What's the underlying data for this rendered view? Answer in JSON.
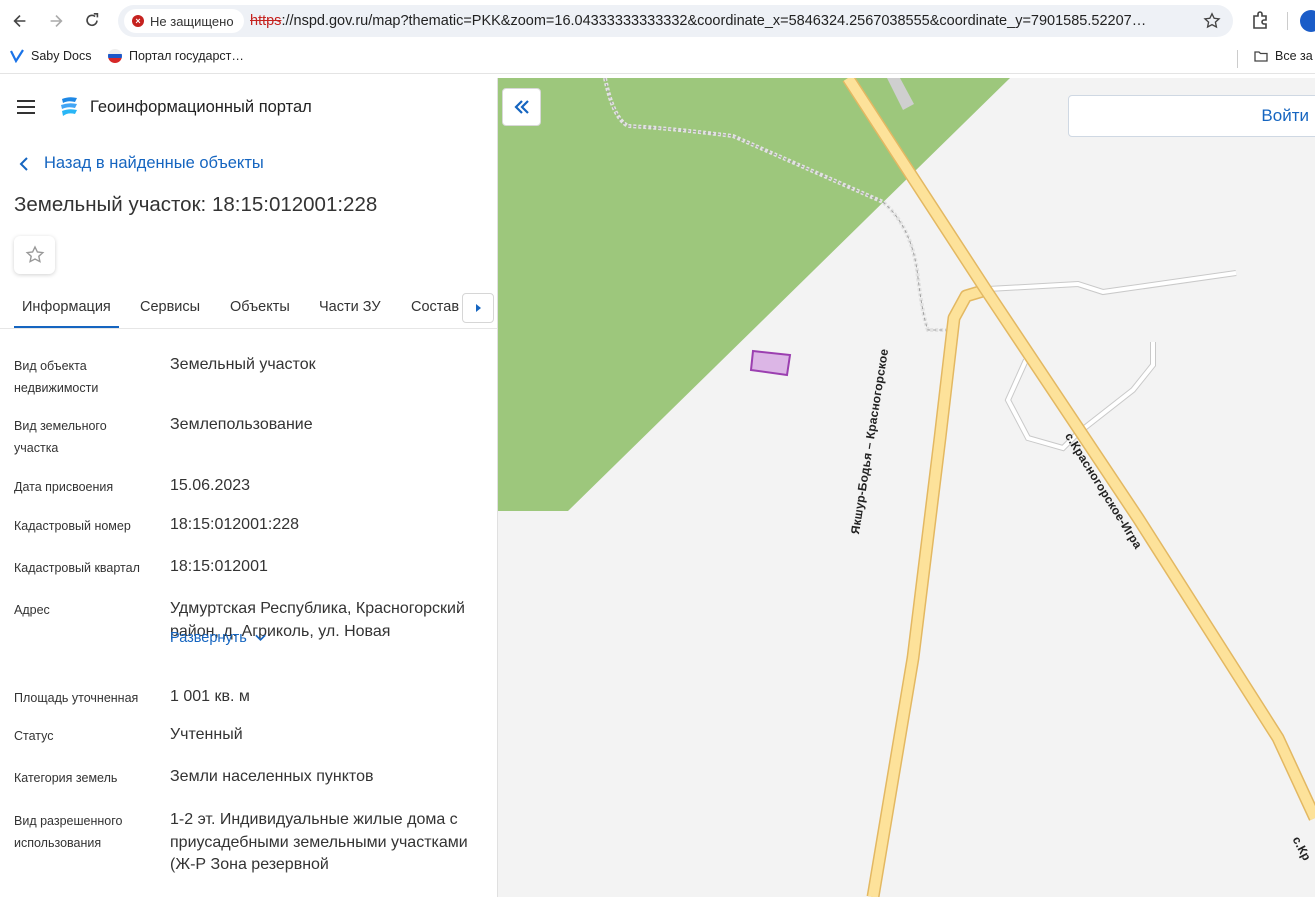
{
  "browser": {
    "insecure_label": "Не защищено",
    "url_scheme": "https",
    "url_rest": "://nspd.gov.ru/map?thematic=PKK&zoom=16.04333333333332&coordinate_x=5846324.2567038555&coordinate_y=7901585.52207…"
  },
  "bookmarks": {
    "items": [
      {
        "label": "Saby Docs",
        "icon": "saby-icon"
      },
      {
        "label": "Портал государст…",
        "icon": "russia-flag-icon"
      }
    ],
    "all_label": "Все за"
  },
  "portal": {
    "title": "Геоинформационный портал"
  },
  "object": {
    "back_label": "Назад в найденные объекты",
    "title": "Земельный участок: 18:15:012001:228"
  },
  "tabs": [
    {
      "label": "Информация"
    },
    {
      "label": "Сервисы"
    },
    {
      "label": "Объекты"
    },
    {
      "label": "Части ЗУ"
    },
    {
      "label": "Состав"
    }
  ],
  "properties": [
    {
      "label": "Вид объекта недвижимости",
      "value": "Земельный участок"
    },
    {
      "label": "Вид земельного участка",
      "value": "Землепользование"
    },
    {
      "label": "Дата присвоения",
      "value": "15.06.2023"
    },
    {
      "label": "Кадастровый номер",
      "value": "18:15:012001:228"
    },
    {
      "label": "Кадастровый квартал",
      "value": "18:15:012001"
    },
    {
      "label": "Адрес",
      "value": "Удмуртская Республика, Красногорский район, д. Агриколь, ул. Новая"
    },
    {
      "label": "Площадь уточненная",
      "value": "1 001 кв. м"
    },
    {
      "label": "Статус",
      "value": "Учтенный"
    },
    {
      "label": "Категория земель",
      "value": "Земли населенных пунктов"
    },
    {
      "label": "Вид разрешенного использования",
      "value": "1-2 эт. Индивидуальные жилые дома с приусадебными земельными участками (Ж-Р Зона резервной"
    }
  ],
  "expand_label": "Развернуть",
  "map": {
    "login_label": "Войти",
    "road_labels": [
      "Якшур-Бодья – Красногорское",
      "с.Красногорское-Игра",
      "с.Кр"
    ],
    "colors": {
      "forest": "#9dc77c",
      "road": "#fde29a",
      "road_edge": "#e0b65a",
      "parcel_fill": "#dcb6e6",
      "parcel_edge": "#9b3fb0",
      "accent": "#1565c0"
    }
  }
}
